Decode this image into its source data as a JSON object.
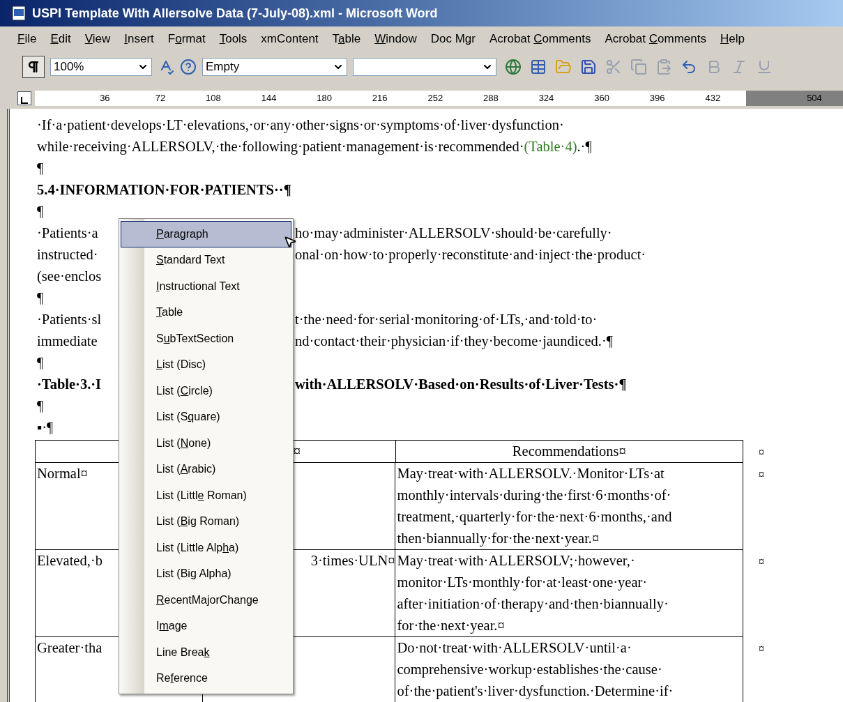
{
  "window": {
    "title": "USPI Template With Allersolve Data (7-July-08).xml - Microsoft Word"
  },
  "menu_bar": [
    {
      "key": "F",
      "post": "ile"
    },
    {
      "key": "E",
      "post": "dit"
    },
    {
      "key": "V",
      "post": "iew"
    },
    {
      "key": "I",
      "post": "nsert"
    },
    {
      "pre": "F",
      "key": "o",
      "post": "rmat"
    },
    {
      "key": "T",
      "post": "ools"
    },
    {
      "pre": "xmContent"
    },
    {
      "pre": "T",
      "key": "a",
      "post": "ble"
    },
    {
      "key": "W",
      "post": "indow"
    },
    {
      "pre": "Doc Mgr"
    },
    {
      "pre": "Acrobat ",
      "key": "C",
      "post": "omments"
    },
    {
      "pre": "Acrobat ",
      "key": "C",
      "post": "omments"
    },
    {
      "key": "H",
      "post": "elp"
    }
  ],
  "toolbar": {
    "show_marks": {
      "on": true
    },
    "zoom": "100%",
    "style": "Empty"
  },
  "ruler": {
    "ticks": [
      "36",
      "72",
      "108",
      "144",
      "180",
      "216",
      "252",
      "288",
      "324",
      "360",
      "396",
      "432"
    ],
    "end_tick": "504"
  },
  "document": [
    {
      "left": "·If·a·patient·develops·LT·elevations,·or·any·other·signs·or·symptoms·of·liver·dysfunction·",
      "bold": false
    },
    {
      "left": "while·receiving·ALLERSOLV,·the·following·patient·management·is·recommended·",
      "link": "(Table·4)",
      "tail": ".·¶",
      "bold": false
    },
    {
      "left": "¶",
      "bold": false
    },
    {
      "left": "5.4·INFORMATION·FOR·PATIENTS··¶",
      "bold": true
    },
    {
      "left": "¶",
      "bold": false
    },
    {
      "left": "·Patients·a",
      "right": "ho·may·administer·ALLERSOLV·should·be·carefully·",
      "bold": false
    },
    {
      "left": "instructed·",
      "right": "onal·on·how·to·properly·reconstitute·and·inject·the·product·",
      "bold": false
    },
    {
      "left": "(see·enclos",
      "bold": false
    },
    {
      "left": "¶",
      "bold": false
    },
    {
      "left": "·Patients·sl",
      "right": "t·the·need·for·serial·monitoring·of·LTs,·and·told·to·",
      "bold": false
    },
    {
      "left": "immediate",
      "right": "nd·contact·their·physician·if·they·become·jaundiced.·¶",
      "bold": false
    },
    {
      "left": "¶",
      "bold": false
    },
    {
      "left": "·Table·3.·I",
      "right": "with·ALLERSOLV·Based·on·Results·of·Liver·Tests·¶",
      "bold": true
    },
    {
      "left": "¶",
      "bold": false
    },
    {
      "left": "▪·¶",
      "bold": false
    }
  ],
  "table": {
    "header": {
      "column_2": "¤",
      "column_3": "Recommendations¤",
      "row_end": "¤"
    },
    "rows": [
      {
        "column_1": "Normal¤",
        "column_3": [
          "May·treat·with·ALLERSOLV.·Monitor·LTs·at",
          "monthly·intervals·during·the·first·6·months·of·",
          "treatment,·quarterly·for·the·next·6·months,·and",
          "then·biannually·for·the·next·year.¤"
        ],
        "row_end": "¤"
      },
      {
        "column_1": "Elevated,·b",
        "column_2": "3·times·ULN¤",
        "column_3": [
          "May·treat·with·ALLERSOLV;·however,·",
          "monitor·LTs·monthly·for·at·least·one·year·",
          "after·initiation·of·therapy·and·then·biannually·",
          "for·the·next·year.¤"
        ],
        "row_end": "¤"
      },
      {
        "column_1": "Greater·tha",
        "column_3": [
          "Do·not·treat·with·ALLERSOLV·until·a·",
          "comprehensive·workup·establishes·the·cause·",
          "of·the·patient's·liver·dysfunction.·Determine·if·"
        ],
        "row_end": "¤"
      }
    ]
  },
  "context_menu": [
    {
      "key": "P",
      "post": "aragraph",
      "selected": true
    },
    {
      "key": "S",
      "post": "tandard Text",
      "selected": false
    },
    {
      "key": "I",
      "post": "nstructional Text",
      "selected": false
    },
    {
      "key": "T",
      "post": "able",
      "selected": false
    },
    {
      "pre": "S",
      "key": "u",
      "post": "bTextSection",
      "selected": false
    },
    {
      "key": "L",
      "post": "ist (Disc)",
      "selected": false
    },
    {
      "pre": "List (",
      "key": "C",
      "post": "ircle)",
      "selected": false
    },
    {
      "pre": "List (S",
      "key": "q",
      "post": "uare)",
      "selected": false
    },
    {
      "pre": "List (",
      "key": "N",
      "post": "one)",
      "selected": false
    },
    {
      "pre": "List (",
      "key": "A",
      "post": "rabic)",
      "selected": false
    },
    {
      "pre": "List (Littl",
      "key": "e",
      "post": " Roman)",
      "selected": false
    },
    {
      "pre": "List (",
      "key": "B",
      "post": "ig Roman)",
      "selected": false
    },
    {
      "pre": "List (Little Alp",
      "key": "h",
      "post": "a)",
      "selected": false
    },
    {
      "pre": "List (Bi",
      "key": "g",
      "post": " Alpha)",
      "selected": false
    },
    {
      "key": "R",
      "post": "ecentMajorChange",
      "selected": false
    },
    {
      "pre": "I",
      "key": "m",
      "post": "age",
      "selected": false
    },
    {
      "pre": "Line Brea",
      "key": "k",
      "selected": false
    },
    {
      "pre": "Re",
      "key": "f",
      "post": "erence",
      "selected": false
    }
  ]
}
